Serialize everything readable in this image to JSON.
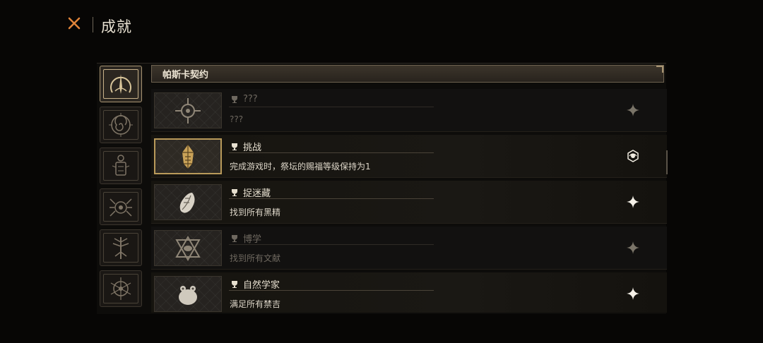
{
  "header": {
    "title": "成就",
    "close_icon": "close-x-icon",
    "accent": "#e0843a"
  },
  "categories": [
    {
      "icon": "arcane-blade-icon",
      "active": true
    },
    {
      "icon": "spiral-sigil-icon",
      "active": false
    },
    {
      "icon": "lantern-sigil-icon",
      "active": false
    },
    {
      "icon": "spider-sigil-icon",
      "active": false
    },
    {
      "icon": "tree-sigil-icon",
      "active": false
    },
    {
      "icon": "thorn-sigil-icon",
      "active": false
    }
  ],
  "section": {
    "title": "帕斯卡契约"
  },
  "achievements": [
    {
      "title": "???",
      "desc": "???",
      "icon": "compass-icon",
      "status_icon": "sparkle-icon",
      "state": "dim"
    },
    {
      "title": "挑战",
      "desc": "完成游戏时，祭坛的赐福等级保持为1",
      "icon": "crystal-icon",
      "status_icon": "emblem-icon",
      "state": "gold"
    },
    {
      "title": "捉迷藏",
      "desc": "找到所有黑精",
      "icon": "seed-icon",
      "status_icon": "sparkle-icon",
      "state": "done"
    },
    {
      "title": "博学",
      "desc": "找到所有文献",
      "icon": "eye-triangle-icon",
      "status_icon": "sparkle-icon",
      "state": "dim"
    },
    {
      "title": "自然学家",
      "desc": "满足所有禁吉",
      "icon": "toad-icon",
      "status_icon": "sparkle-icon",
      "state": "done"
    }
  ]
}
